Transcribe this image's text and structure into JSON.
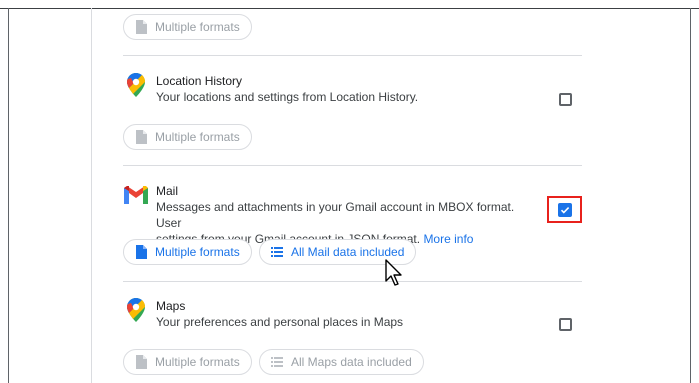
{
  "items": [
    {
      "key": "prev",
      "chips": [
        {
          "label": "Multiple formats"
        }
      ]
    },
    {
      "key": "location_history",
      "title": "Location History",
      "description": "Your locations and settings from Location History.",
      "checked": false,
      "chips": [
        {
          "label": "Multiple formats"
        }
      ]
    },
    {
      "key": "mail",
      "title": "Mail",
      "description_line1": "Messages and attachments in your Gmail account in MBOX format. User",
      "description_line2": "settings from your Gmail account in JSON format.",
      "more_info": "More info",
      "checked": true,
      "chips": [
        {
          "label": "Multiple formats"
        },
        {
          "label": "All Mail data included"
        }
      ]
    },
    {
      "key": "maps",
      "title": "Maps",
      "description": "Your preferences and personal places in Maps",
      "checked": false,
      "chips": [
        {
          "label": "Multiple formats"
        },
        {
          "label": "All Maps data included"
        }
      ]
    }
  ],
  "colors": {
    "accent": "#1a73e8",
    "highlight": "#e8211c",
    "disabled_text": "#9aa0a6",
    "divider": "#dadce0"
  }
}
